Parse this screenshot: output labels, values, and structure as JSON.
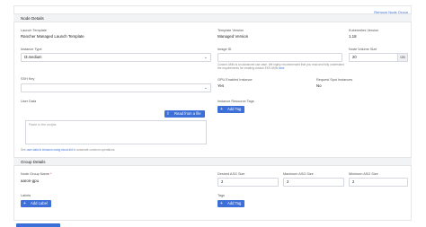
{
  "remove_node_group": "Remove Node Group",
  "sections": {
    "node_details": "Node Details",
    "group_details": "Group Details"
  },
  "launch_template": {
    "label": "Launch Template",
    "value": "Rancher Managed Launch Template"
  },
  "template_version": {
    "label": "Template Version",
    "value": "Managed Version"
  },
  "kubernetes_version": {
    "label": "Kubernetes Version",
    "value": "1.18"
  },
  "instance_type": {
    "label": "Instance Type",
    "value": "t3.medium"
  },
  "image_id": {
    "label": "Image ID",
    "help_prefix": "Custom AMIs is an advanced use case. We highly recommended that you read and fully understand the requirements for creating custom EKS AMIs ",
    "help_link": "here"
  },
  "node_volume_size": {
    "label": "Node Volume Size",
    "value": "20",
    "unit": "GB"
  },
  "ssh_key": {
    "label": "SSH Key"
  },
  "gpu_enabled": {
    "label": "GPU Enabled Instance",
    "value": "Yes"
  },
  "request_spot": {
    "label": "Request Spot Instances",
    "value": "No"
  },
  "user_data": {
    "label": "User Data",
    "read_button": "Read from a file",
    "placeholder": "Paste in the scripts",
    "help_prefix": "See ",
    "help_link": "user data in Amazon using cloud-init",
    "help_suffix": " to automate common operations."
  },
  "instance_resource_tags": {
    "label": "Instance Resource Tags",
    "add_tag": "Add Tag"
  },
  "node_group_name": {
    "label": "Node Group Name",
    "required": "*",
    "value": "aaron-gpu"
  },
  "desired_asg": {
    "label": "Desired ASG Size",
    "value": "2"
  },
  "maximum_asg": {
    "label": "Maximum ASG Size",
    "value": "2"
  },
  "minimum_asg": {
    "label": "Minimum ASG Size",
    "value": "2"
  },
  "labels": {
    "label": "Labels",
    "add_label": "Add Label"
  },
  "tags": {
    "label": "Tags",
    "add_tag": "Add Tag"
  },
  "icons": {
    "plus": "plus-icon",
    "upload": "upload-icon",
    "chevron": "chevron-down-icon"
  },
  "colors": {
    "accent": "#3d6fd9",
    "band": "#f2f3f5"
  }
}
